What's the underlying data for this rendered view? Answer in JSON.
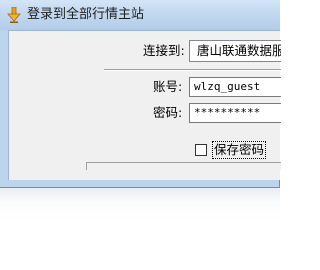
{
  "window": {
    "title": "登录到全部行情主站",
    "icon": "download-arrow-icon"
  },
  "form": {
    "connect_label": "连接到:",
    "connect_value": "唐山联通数据服务",
    "account_label": "账号:",
    "account_value": "wlzq_guest",
    "password_label": "密码:",
    "password_value": "**********",
    "save_password_label": "保存密码",
    "save_password_checked": false
  },
  "colors": {
    "titlebar": "#bfd6ef",
    "client_bg": "#f0f0f0",
    "icon_accent": "#e6a01e"
  }
}
